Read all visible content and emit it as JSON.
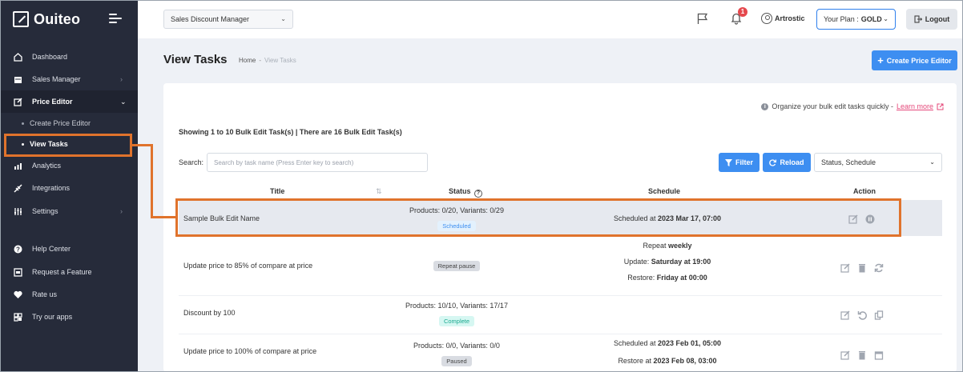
{
  "app": {
    "brand": "Ouiteo"
  },
  "sidebar": {
    "items": [
      {
        "label": "Dashboard",
        "icon": "home-icon"
      },
      {
        "label": "Sales Manager",
        "icon": "calendar-icon",
        "chevron": "›"
      },
      {
        "label": "Price Editor",
        "icon": "edit-icon",
        "chevron": "⌄"
      },
      {
        "label": "Analytics",
        "icon": "chart-icon"
      },
      {
        "label": "Integrations",
        "icon": "plug-icon"
      },
      {
        "label": "Settings",
        "icon": "sliders-icon",
        "chevron": "›"
      },
      {
        "label": "Help Center",
        "icon": "help-icon"
      },
      {
        "label": "Request a Feature",
        "icon": "request-icon"
      },
      {
        "label": "Rate us",
        "icon": "heart-icon"
      },
      {
        "label": "Try our apps",
        "icon": "apps-icon"
      }
    ],
    "subitems": [
      {
        "label": "Create Price Editor"
      },
      {
        "label": "View Tasks"
      }
    ]
  },
  "topbar": {
    "app_select": "Sales Discount Manager",
    "notification_count": "1",
    "user": "Artrostic",
    "plan_prefix": "Your Plan :",
    "plan_name": "GOLD",
    "logout": "Logout"
  },
  "page": {
    "title": "View Tasks",
    "breadcrumb_home": "Home",
    "breadcrumb_sep": "-",
    "breadcrumb_current": "View Tasks",
    "create_button": "Create Price Editor"
  },
  "card": {
    "tip_text": "Organize your bulk edit tasks quickly -",
    "tip_link": "Learn more",
    "showing": "Showing 1 to 10 Bulk Edit Task(s) | There are 16 Bulk Edit Task(s)",
    "search_label": "Search:",
    "search_placeholder": "Search by task name (Press Enter key to search)",
    "filter_button": "Filter",
    "reload_button": "Reload",
    "status_select": "Status, Schedule"
  },
  "table": {
    "headers": {
      "title": "Title",
      "status": "Status",
      "schedule": "Schedule",
      "action": "Action"
    },
    "rows": [
      {
        "title": "Sample Bulk Edit Name",
        "status_line": "Products: 0/20, Variants: 0/29",
        "status_pill": "Scheduled",
        "schedule_prefix": "Scheduled at",
        "schedule_value": "2023 Mar 17, 07:00"
      },
      {
        "title": "Update price to 85% of compare at price",
        "status_pill": "Repeat pause",
        "repeat_prefix": "Repeat",
        "repeat_value": "weekly",
        "update_prefix": "Update:",
        "update_value": "Saturday at 19:00",
        "restore_prefix": "Restore:",
        "restore_value": "Friday at 00:00"
      },
      {
        "title": "Discount by 100",
        "status_line": "Products: 10/10, Variants: 17/17",
        "status_pill": "Complete"
      },
      {
        "title": "Update price to 100% of compare at price",
        "status_line": "Products: 0/0, Variants: 0/0",
        "status_pill": "Paused",
        "schedule_prefix": "Scheduled at",
        "schedule_value": "2023 Feb 01, 05:00",
        "restore_prefix": "Restore at",
        "restore_value": "2023 Feb 08, 03:00"
      }
    ]
  },
  "colors": {
    "accent": "#3d8ef1",
    "sidebar": "#262b3a",
    "callout": "#e0732c"
  }
}
